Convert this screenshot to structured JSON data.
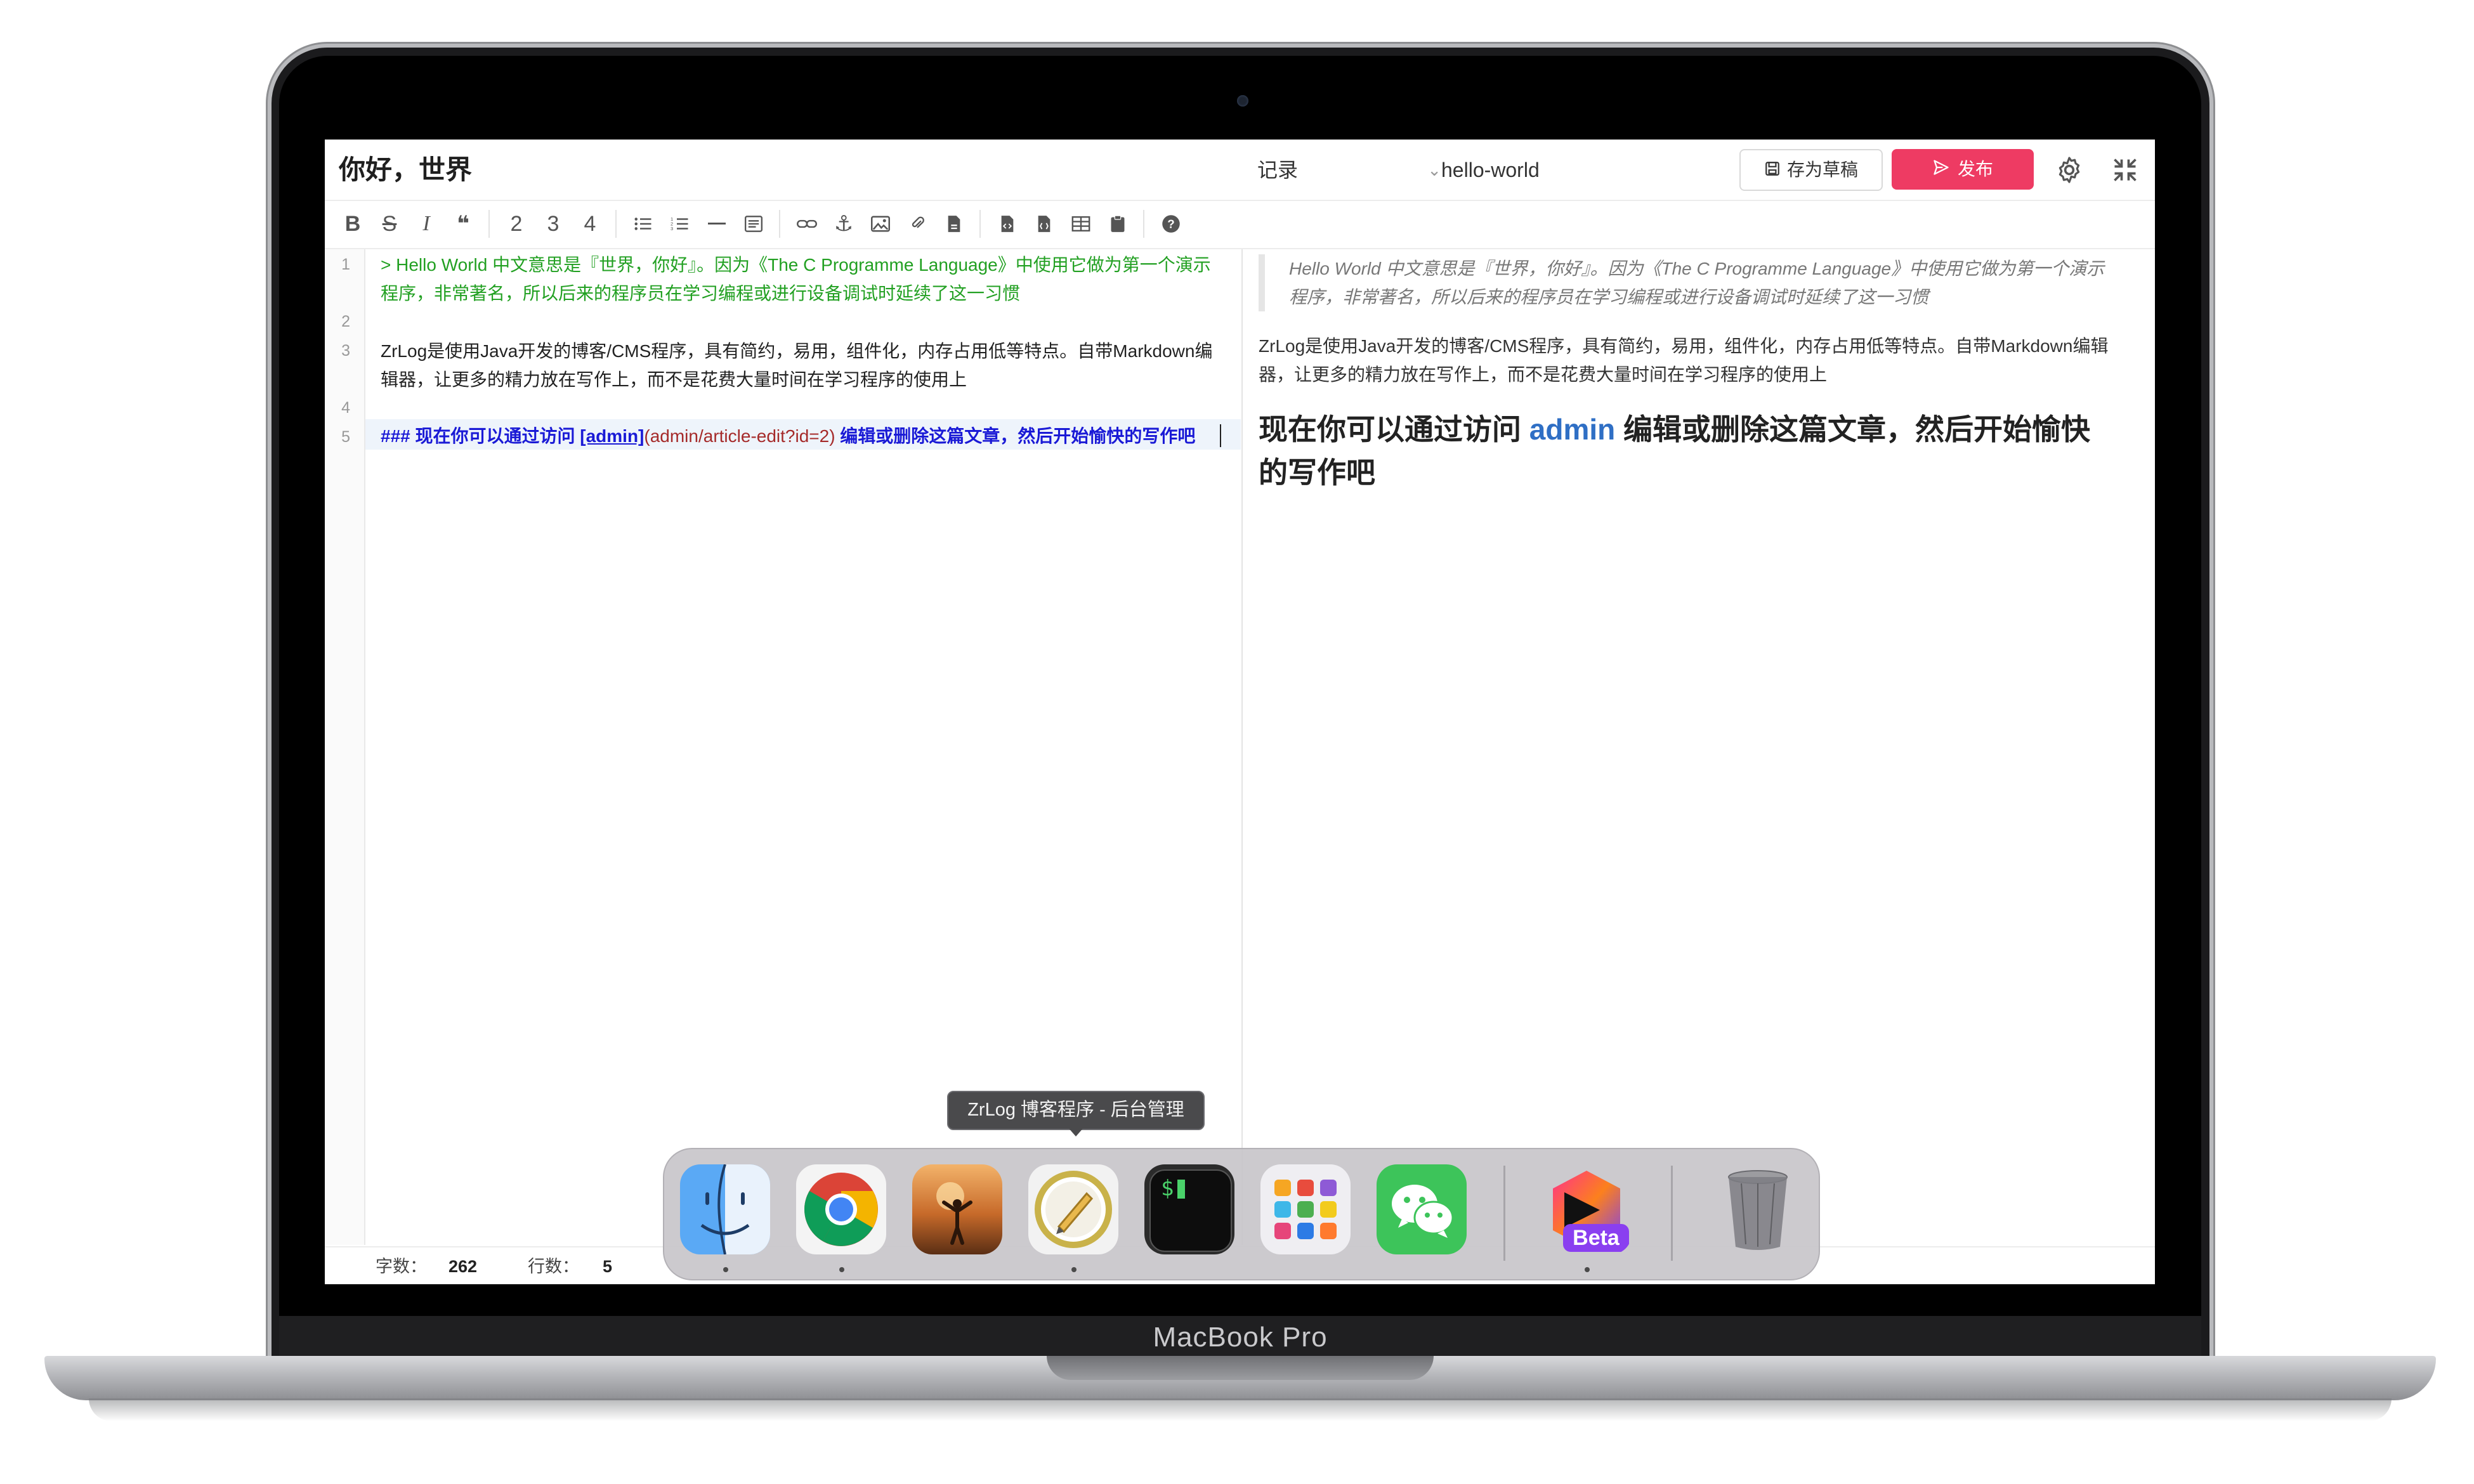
{
  "device": {
    "label": "MacBook Pro"
  },
  "header": {
    "title": "你好，世界",
    "category": "记录",
    "alias": "hello-world",
    "save_draft_label": "存为草稿",
    "publish_label": "发布"
  },
  "toolbar": {
    "items": [
      "bold",
      "strikethrough",
      "italic",
      "quote",
      "h2",
      "h3",
      "h4",
      "unordered-list",
      "ordered-list",
      "hr",
      "code-block",
      "link",
      "anchor",
      "image",
      "attachment",
      "file",
      "html-entities",
      "page-break",
      "table",
      "paste",
      "help"
    ],
    "h2": "2",
    "h3": "3",
    "h4": "4"
  },
  "editor": {
    "line_numbers": [
      "1",
      "",
      "2",
      "3",
      "",
      "4",
      "5"
    ],
    "line1a": "> Hello World 中文意思是『世界，你好』。因为《The C Programme Language》中使用它做为第一个演示",
    "line1b": "程序，非常著名，所以后来的程序员在学习编程或进行设备调试时延续了这一习惯",
    "line3a": "ZrLog是使用Java开发的博客/CMS程序，具有简约，易用，组件化，内存占用低等特点。自带Markdown编",
    "line3b": "辑器，让更多的精力放在写作上，而不是花费大量时间在学习程序的使用上",
    "line5_prefix": "### 现在你可以通过访问 ",
    "line5_link": "[admin]",
    "line5_url": "(admin/article-edit?id=2)",
    "line5_suffix": " 编辑或删除这篇文章，然后开始愉快的写作吧"
  },
  "preview": {
    "quote_a": "Hello World 中文意思是『世界，你好』。因为《The C Programme Language》中使用它做为第一个演示",
    "quote_b": "程序，非常著名，所以后来的程序员在学习编程或进行设备调试时延续了这一习惯",
    "para_a": "ZrLog是使用Java开发的博客/CMS程序，具有简约，易用，组件化，内存占用低等特点。自带Markdown编辑",
    "para_b": "器，让更多的精力放在写作上，而不是花费大量时间在学习程序的使用上",
    "heading_prefix": "现在你可以通过访问 ",
    "heading_link": "admin",
    "heading_suffix_a": " 编辑或删除这篇文章，然后开始愉快",
    "heading_suffix_b": "的写作吧"
  },
  "status": {
    "chars_label": "字数：",
    "chars_value": "262",
    "lines_label": "行数：",
    "lines_value": "5"
  },
  "dock": {
    "tooltip": "ZrLog 博客程序 - 后台管理",
    "items": [
      "finder-icon",
      "chrome-icon",
      "photo-app-icon",
      "zrlog-app-icon",
      "terminal-icon",
      "launchpad-icon",
      "wechat-icon",
      "jetbrains-beta-icon",
      "trash-icon"
    ],
    "beta_label": "Beta",
    "terminal_prompt": "$"
  },
  "colors": {
    "publish": "#ee3b63",
    "quote_green": "#22a022",
    "heading_blue": "#1a1ad6",
    "link_blue": "#2f6fc5"
  }
}
